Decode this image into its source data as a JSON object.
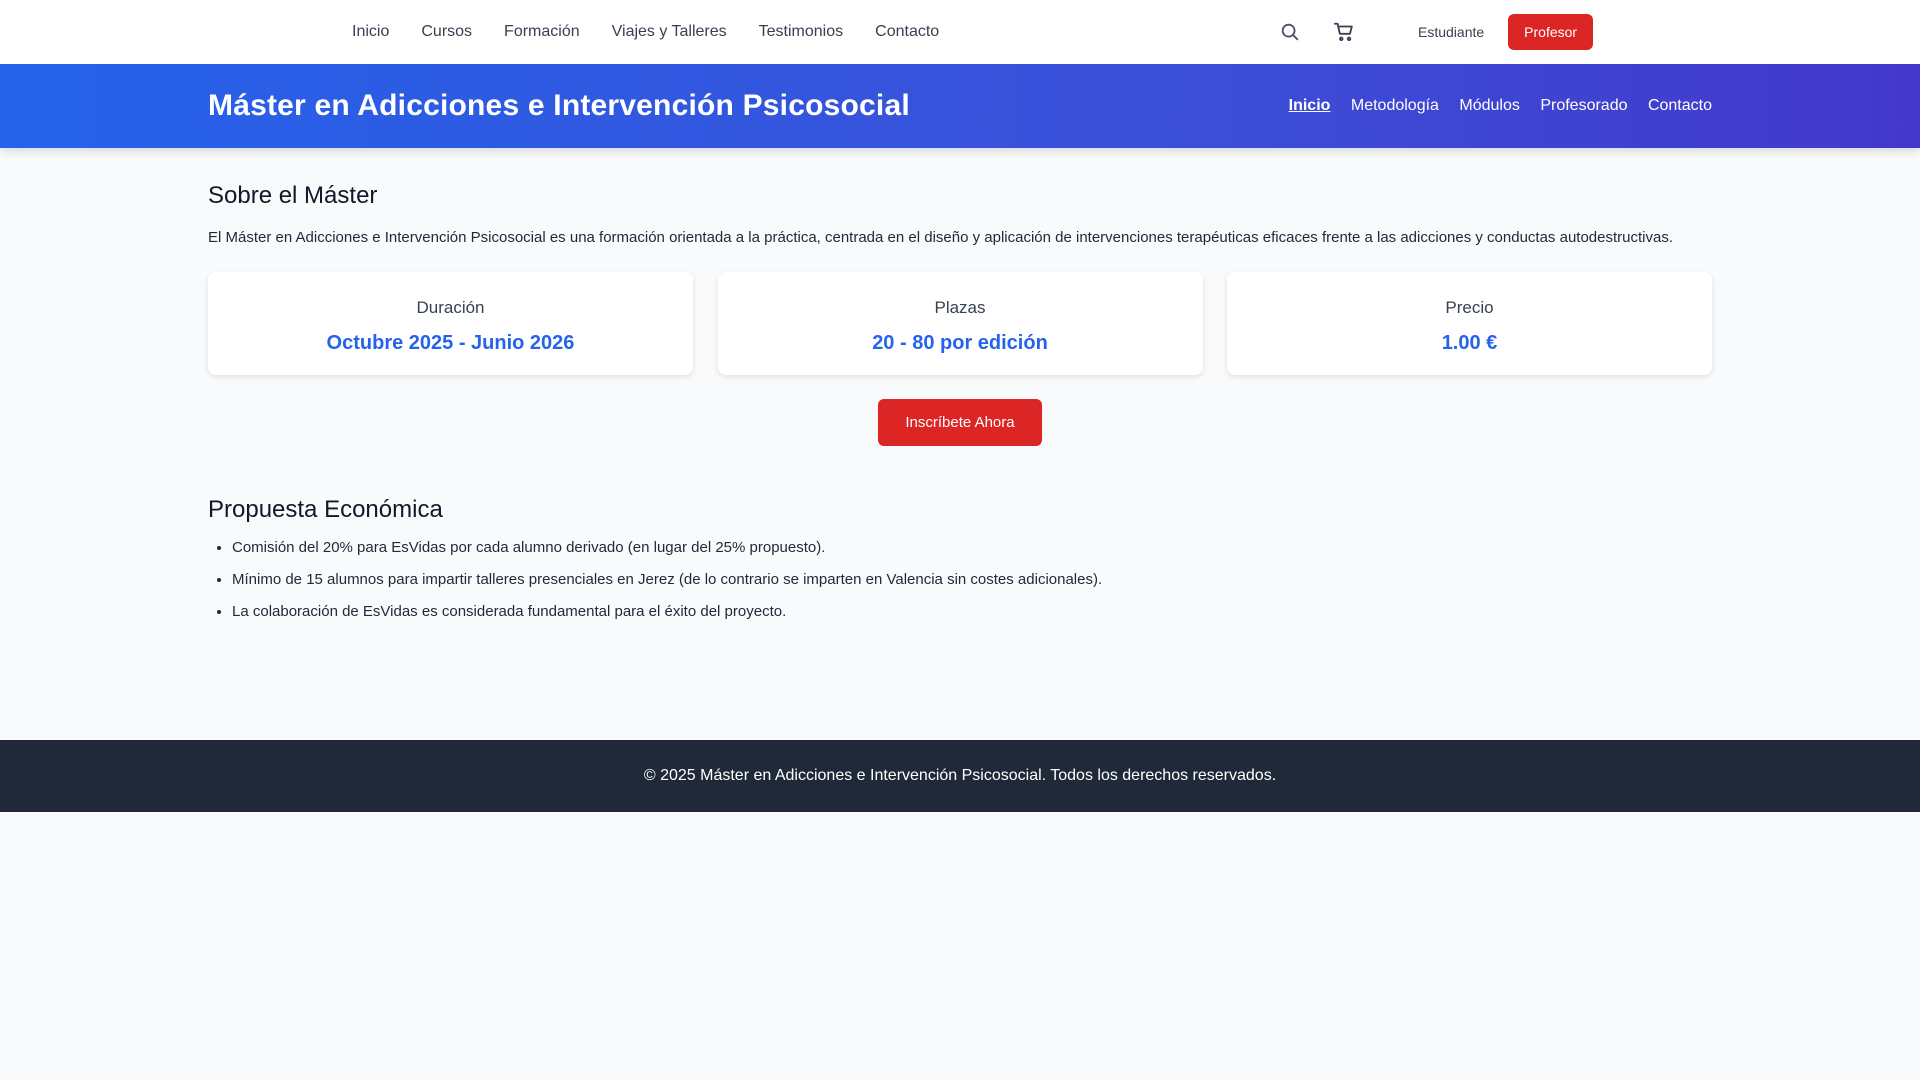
{
  "topnav": {
    "links": [
      "Inicio",
      "Cursos",
      "Formación",
      "Viajes y Talleres",
      "Testimonios",
      "Contacto"
    ],
    "icons": [
      "search-icon",
      "cart-icon"
    ],
    "student_label": "Estudiante",
    "teacher_label": "Profesor"
  },
  "hero": {
    "title": "Máster en Adicciones e Intervención Psicosocial",
    "nav": [
      "Inicio",
      "Metodología",
      "Módulos",
      "Profesorado",
      "Contacto"
    ],
    "active": "Inicio"
  },
  "about": {
    "heading": "Sobre el Máster",
    "description": "El Máster en Adicciones e Intervención Psicosocial es una formación orientada a la práctica, centrada en el diseño y aplicación de intervenciones terapéuticas eficaces frente a las adicciones y conductas autodestructivas."
  },
  "cards": [
    {
      "label": "Duración",
      "value": "Octubre 2025 - Junio 2026"
    },
    {
      "label": "Plazas",
      "value": "20 - 80 por edición"
    },
    {
      "label": "Precio",
      "value": "1.00 €"
    }
  ],
  "cta": "Inscríbete Ahora",
  "proposal": {
    "heading": "Propuesta Económica",
    "items": [
      "Comisión del 20% para EsVidas por cada alumno derivado (en lugar del 25% propuesto).",
      "Mínimo de 15 alumnos para impartir talleres presenciales en Jerez (de lo contrario se imparten en Valencia sin costes adicionales).",
      "La colaboración de EsVidas es considerada fundamental para el éxito del proyecto."
    ]
  },
  "footer": "© 2025 Máster en Adicciones e Intervención Psicosocial. Todos los derechos reservados.",
  "colors": {
    "accent_red": "#dc2626",
    "accent_blue": "#2563eb",
    "hero_gradient_end": "#4338ca",
    "footer_bg": "#1f2937"
  }
}
